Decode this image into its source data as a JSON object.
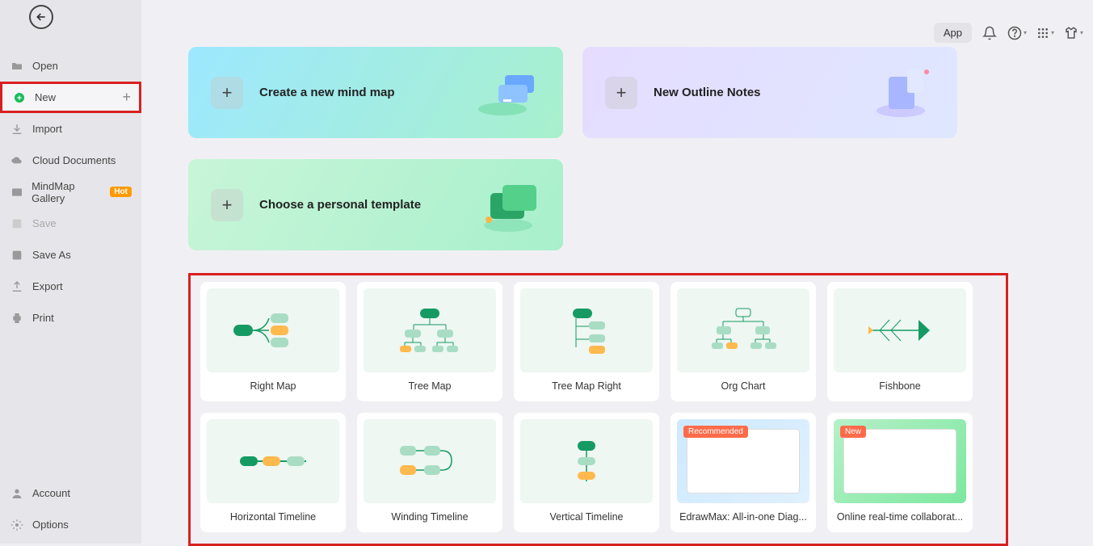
{
  "topbar": {
    "app": "App"
  },
  "sidebar": {
    "items": [
      {
        "label": "Open"
      },
      {
        "label": "New"
      },
      {
        "label": "Import"
      },
      {
        "label": "Cloud Documents"
      },
      {
        "label": "MindMap Gallery",
        "badge": "Hot"
      },
      {
        "label": "Save"
      },
      {
        "label": "Save As"
      },
      {
        "label": "Export"
      },
      {
        "label": "Print"
      }
    ],
    "bottom": [
      {
        "label": "Account"
      },
      {
        "label": "Options"
      }
    ]
  },
  "cards": {
    "mindmap": "Create a new mind map",
    "outline": "New Outline Notes",
    "personal": "Choose a personal template"
  },
  "templates": {
    "row1": [
      {
        "label": "Right Map"
      },
      {
        "label": "Tree Map"
      },
      {
        "label": "Tree Map Right"
      },
      {
        "label": "Org Chart"
      },
      {
        "label": "Fishbone"
      }
    ],
    "row2": [
      {
        "label": "Horizontal Timeline"
      },
      {
        "label": "Winding Timeline"
      },
      {
        "label": "Vertical Timeline"
      },
      {
        "label": "EdrawMax: All-in-one Diag...",
        "tag": "Recommended"
      },
      {
        "label": "Online real-time collaborat...",
        "tag": "New"
      }
    ]
  }
}
